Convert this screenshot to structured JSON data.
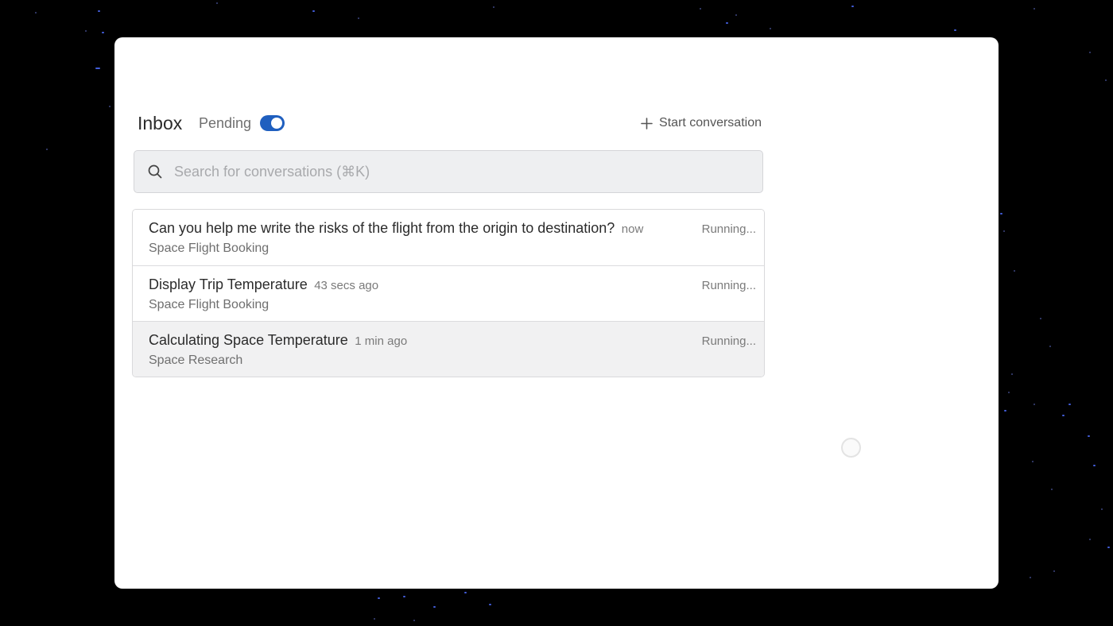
{
  "header": {
    "title": "Inbox",
    "pending_label": "Pending",
    "pending_toggle_on": true,
    "start_conversation_label": "Start conversation"
  },
  "search": {
    "placeholder": "Search for conversations (⌘K)"
  },
  "conversations": [
    {
      "title": "Can you help me write the risks of the flight from the origin to destination?",
      "time": "now",
      "project": "Space Flight Booking",
      "status": "Running..."
    },
    {
      "title": "Display Trip Temperature",
      "time": "43 secs ago",
      "project": "Space Flight Booking",
      "status": "Running..."
    },
    {
      "title": "Calculating Space Temperature",
      "time": "1 min ago",
      "project": "Space Research",
      "status": "Running..."
    }
  ],
  "icons": {
    "start": "plus-icon",
    "search": "search-icon"
  },
  "colors": {
    "accent": "#1f5fbf",
    "background": "#000000",
    "star": "#4d6dff"
  }
}
